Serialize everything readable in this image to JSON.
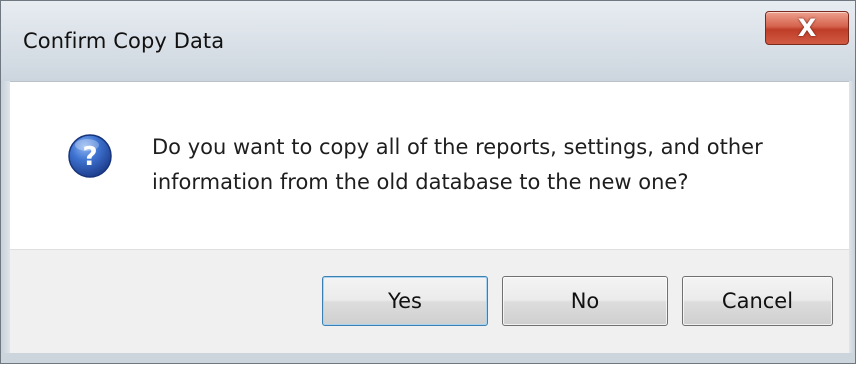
{
  "dialog": {
    "title": "Confirm Copy Data",
    "close_icon": "close-icon",
    "close_glyph": "X",
    "icon": "question-icon",
    "icon_glyph": "?",
    "message": "Do you want to copy all of the reports, settings, and other\ninformation from the old database to the new one?",
    "buttons": {
      "yes_label": "Yes",
      "no_label": "No",
      "cancel_label": "Cancel"
    },
    "colors": {
      "close_button": "#c84631",
      "icon_blue": "#2f5fbe",
      "default_button_border": "#3c7fb1"
    }
  }
}
